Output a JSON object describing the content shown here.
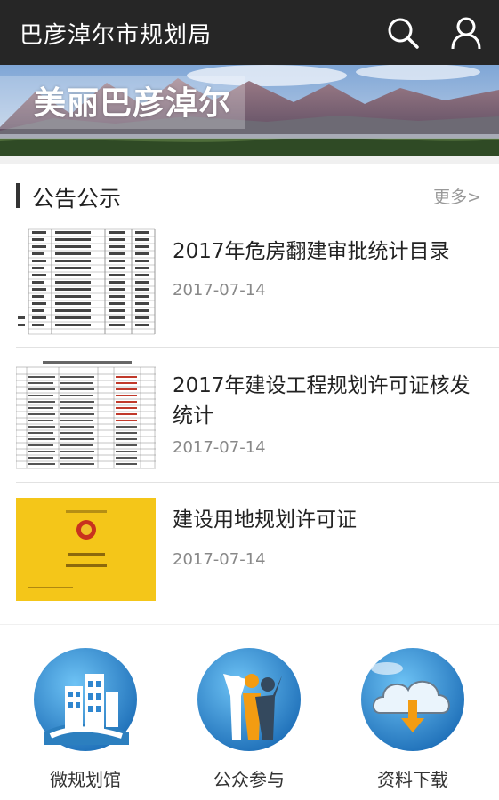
{
  "header": {
    "title": "巴彦淖尔市规划局",
    "search_icon": "search-icon",
    "user_icon": "user-icon"
  },
  "banner": {
    "text": "美丽巴彦淖尔"
  },
  "notices": {
    "heading": "公告公示",
    "more_label": "更多>",
    "items": [
      {
        "title": "2017年危房翻建审批统计目录",
        "date": "2017-07-14"
      },
      {
        "title": "2017年建设工程规划许可证核发统计",
        "date": "2017-07-14"
      },
      {
        "title": "建设用地规划许可证",
        "date": "2017-07-14"
      }
    ]
  },
  "features": [
    {
      "label": "微规划馆",
      "icon": "buildings-icon"
    },
    {
      "label": "公众参与",
      "icon": "people-icon"
    },
    {
      "label": "资料下载",
      "icon": "cloud-download-icon"
    }
  ],
  "colors": {
    "header_bg": "#262626",
    "accent_blue": "#2f86cf",
    "certificate_yellow": "#f4c619"
  }
}
